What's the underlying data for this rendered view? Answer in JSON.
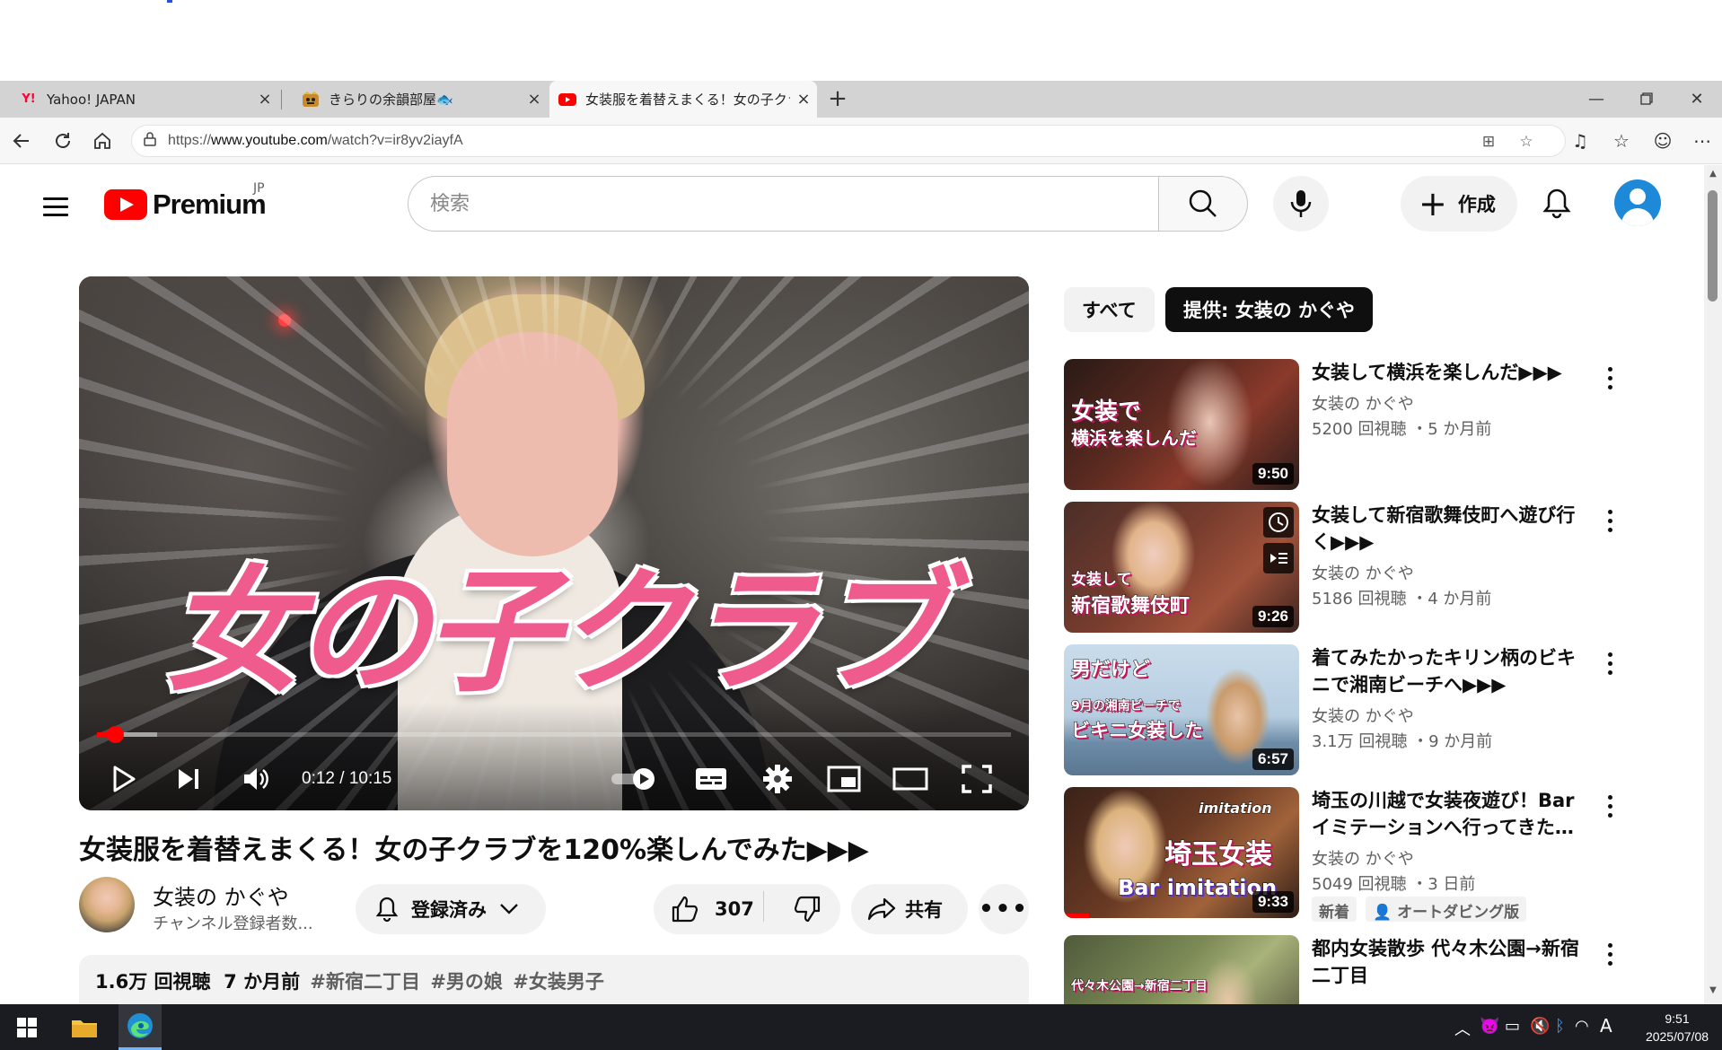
{
  "browser": {
    "tabs": [
      {
        "title": "Yahoo! JAPAN",
        "favicon": "yahoo-icon"
      },
      {
        "title": "きらりの余韻部屋🐟",
        "favicon": "emoji-icon"
      },
      {
        "title": "女装服を着替えまくる！女の子クラブ",
        "favicon": "youtube-icon"
      }
    ],
    "url_prefix": "https://",
    "url_domain": "www.youtube.com",
    "url_path": "/watch?v=ir8yv2iayfA"
  },
  "masthead": {
    "logo_text": "Premium",
    "country_code": "JP",
    "search_placeholder": "検索",
    "create_label": "作成"
  },
  "player": {
    "overlay_text": "女の子クラブ",
    "time_display": "0:12 / 10:15",
    "progress_fraction": 0.02,
    "buffered_fraction": 0.066
  },
  "video": {
    "title": "女装服を着替えまくる！女の子クラブを120%楽しんでみた▶▶▶",
    "channel_name": "女装の かぐや",
    "subscriber_text": "チャンネル登録者数...",
    "subscribe_label": "登録済み",
    "like_count": "307",
    "share_label": "共有",
    "views": "1.6万 回視聴",
    "age": "7 か月前",
    "hashtags": [
      "#新宿二丁目",
      "#男の娘",
      "#女装男子"
    ]
  },
  "chips": [
    {
      "label": "すべて",
      "selected": false
    },
    {
      "label": "提供: 女装の かぐや",
      "selected": true
    }
  ],
  "recommendations": [
    {
      "title": "女装して横浜を楽しんだ▶▶▶",
      "channel": "女装の かぐや",
      "meta": "5200 回視聴 ・5 か月前",
      "duration": "9:50",
      "thumb_text": [
        "女装で",
        "横浜を楽しんだ"
      ]
    },
    {
      "title": "女装して新宿歌舞伎町へ遊び行く▶▶▶",
      "channel": "女装の かぐや",
      "meta": "5186 回視聴 ・4 か月前",
      "duration": "9:26",
      "thumb_text": [
        "女装して",
        "新宿歌舞伎町"
      ]
    },
    {
      "title": "着てみたかったキリン柄のビキニで湘南ビーチへ▶▶▶",
      "channel": "女装の かぐや",
      "meta": "3.1万 回視聴 ・9 か月前",
      "duration": "6:57",
      "thumb_text": [
        "男だけど",
        "9月の湘南ビーチで",
        "ビキニ女装した"
      ]
    },
    {
      "title": "埼玉の川越で女装夜遊び！Barイミテーションへ行ってきた…",
      "channel": "女装の かぐや",
      "meta": "5049 回視聴 ・3 日前",
      "duration": "9:33",
      "thumb_text": [
        "imitation",
        "埼玉女装",
        "Bar imitation"
      ],
      "badges": [
        "新着",
        "オートダビング版"
      ]
    },
    {
      "title": "都内女装散歩 代々木公園→新宿二丁目",
      "channel": "",
      "meta": "",
      "duration": "",
      "thumb_text": [
        "代々木公園→新宿二丁目"
      ]
    }
  ],
  "taskbar": {
    "time": "9:51",
    "date": "2025/07/08",
    "ime": "A"
  },
  "colors": {
    "yt_red": "#ff0000",
    "overlay_pink": "#ee5b8c",
    "chip_selected": "#0f0f0f"
  }
}
